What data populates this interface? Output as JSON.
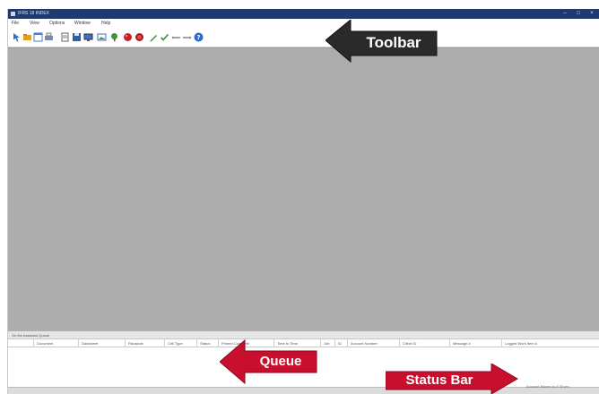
{
  "window": {
    "title": "IFRS 18 INDEX",
    "controls": [
      "–",
      "□",
      "×"
    ]
  },
  "menubar": {
    "items": [
      "File",
      "View",
      "Options",
      "Window",
      "Help"
    ]
  },
  "toolbar": {
    "tools": [
      "cursor-icon",
      "open-folder-icon",
      "window-icon",
      "print-icon",
      "document-icon",
      "diskette-icon",
      "monitor-icon",
      "image-icon",
      "tree-icon",
      "record-red-icon",
      "stop-red-icon",
      "pencil-icon",
      "check-icon",
      "line-tool-icon",
      "link-tool-icon",
      "help-icon"
    ]
  },
  "queue": {
    "header": "On the Assistant Queue",
    "columns": [
      "",
      "Document",
      "Datasheet",
      "Rdcalade",
      "Cell Type",
      "Status",
      "Printed Complete",
      "Time to Time",
      "Job",
      "ID",
      "Account Number",
      "Client ID",
      "Message #",
      "Logged Work Item #"
    ]
  },
  "statusbar": {
    "text": "Account Moved to 4:30 pm"
  },
  "callouts": {
    "toolbar": "Toolbar",
    "queue": "Queue",
    "status_bar": "Status Bar"
  },
  "colors": {
    "title_bar": "#1f3b6e",
    "workspace": "#adadad",
    "callout_dark": "#2a2a2a",
    "callout_red": "#c8102e"
  }
}
